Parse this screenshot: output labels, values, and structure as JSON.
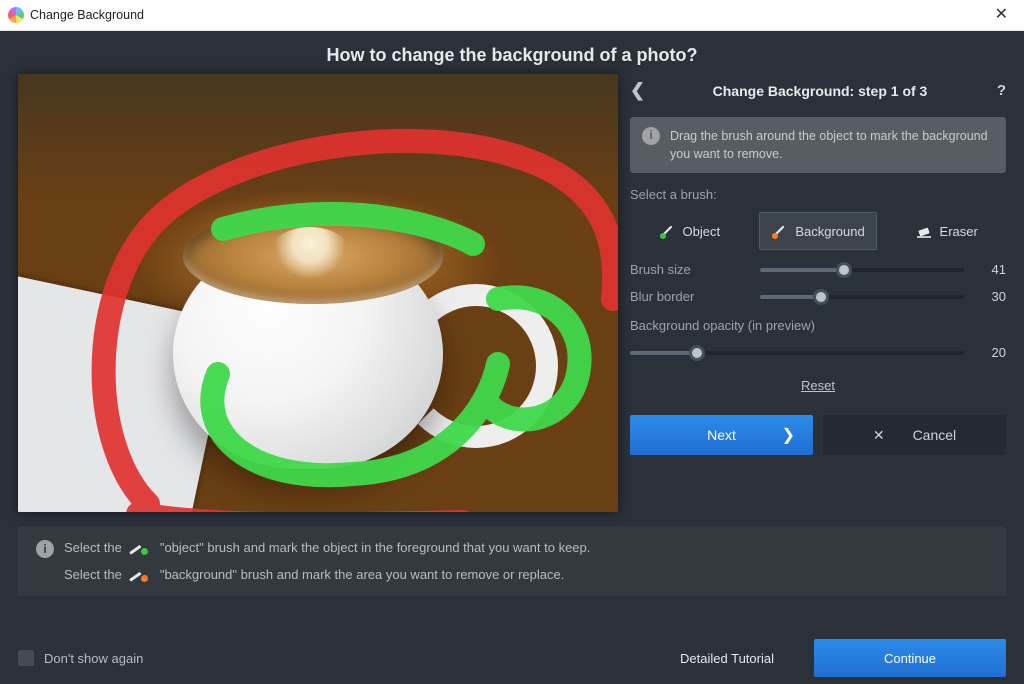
{
  "window": {
    "title": "Change Background"
  },
  "heading": "How to change the background of a photo?",
  "panel": {
    "title": "Change Background: step 1 of 3",
    "hint": "Drag the brush around the object to mark the background you want to remove.",
    "brush_label": "Select a brush:",
    "brushes": {
      "object": "Object",
      "background": "Background",
      "eraser": "Eraser",
      "selected": "background"
    },
    "sliders": {
      "brush_size": {
        "label": "Brush size",
        "value": 41,
        "pct": 41
      },
      "blur_border": {
        "label": "Blur border",
        "value": 30,
        "pct": 30
      },
      "bg_opacity": {
        "label": "Background opacity (in preview)",
        "value": 20,
        "pct": 20
      }
    },
    "reset": "Reset",
    "next": "Next",
    "cancel": "Cancel"
  },
  "instructions": {
    "line1_a": "Select the",
    "line1_b": "\"object\" brush and mark the object in the foreground that you want to keep.",
    "line2_a": "Select the",
    "line2_b": "\"background\" brush and mark the area you want to remove or replace."
  },
  "bottom": {
    "dont_show": "Don't show again",
    "tutorial": "Detailed Tutorial",
    "continue": "Continue"
  },
  "colors": {
    "accent": "#2d8bea",
    "object_dot": "#36c93e",
    "background_dot": "#ff7a26"
  }
}
